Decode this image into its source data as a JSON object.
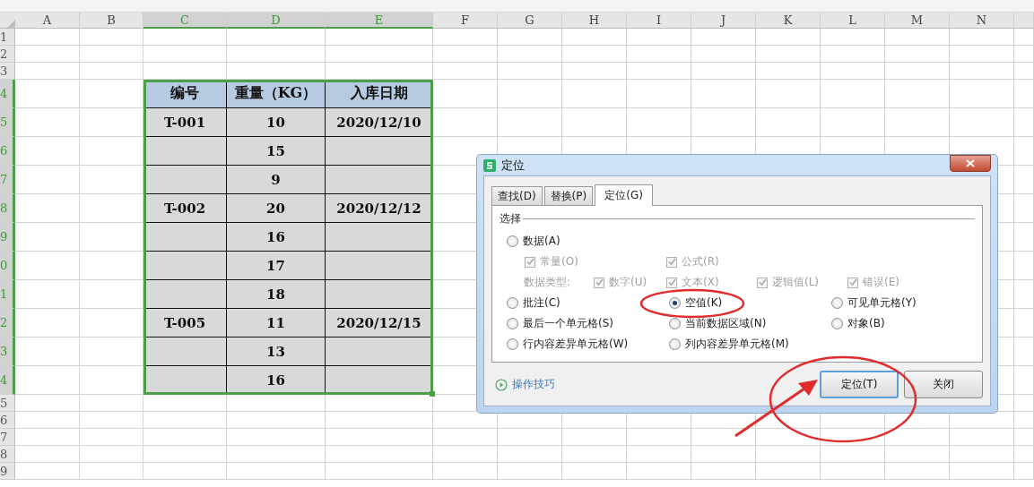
{
  "column_headers": [
    {
      "label": "A",
      "selected": false
    },
    {
      "label": "B",
      "selected": false
    },
    {
      "label": "C",
      "selected": true
    },
    {
      "label": "D",
      "selected": true
    },
    {
      "label": "E",
      "selected": true
    },
    {
      "label": "F",
      "selected": false
    },
    {
      "label": "G",
      "selected": false
    },
    {
      "label": "H",
      "selected": false
    },
    {
      "label": "I",
      "selected": false
    },
    {
      "label": "J",
      "selected": false
    },
    {
      "label": "K",
      "selected": false
    },
    {
      "label": "L",
      "selected": false
    },
    {
      "label": "M",
      "selected": false
    },
    {
      "label": "N",
      "selected": false
    }
  ],
  "row_headers": [
    {
      "label": "1",
      "selected": false
    },
    {
      "label": "2",
      "selected": false
    },
    {
      "label": "3",
      "selected": false
    },
    {
      "label": "4",
      "selected": true
    },
    {
      "label": "5",
      "selected": true
    },
    {
      "label": "6",
      "selected": true
    },
    {
      "label": "7",
      "selected": true
    },
    {
      "label": "8",
      "selected": true
    },
    {
      "label": "9",
      "selected": true
    },
    {
      "label": "0",
      "selected": true
    },
    {
      "label": "1",
      "selected": true
    },
    {
      "label": "2",
      "selected": true
    },
    {
      "label": "3",
      "selected": true
    },
    {
      "label": "4",
      "selected": true
    },
    {
      "label": "5",
      "selected": false
    },
    {
      "label": "6",
      "selected": false
    },
    {
      "label": "7",
      "selected": false
    },
    {
      "label": "8",
      "selected": false
    },
    {
      "label": "9",
      "selected": false
    }
  ],
  "table": {
    "columns": [
      "编号",
      "重量（KG）",
      "入库日期"
    ],
    "rows": [
      [
        "T-001",
        "10",
        "2020/12/10"
      ],
      [
        null,
        "15",
        null
      ],
      [
        null,
        "9",
        null
      ],
      [
        "T-002",
        "20",
        "2020/12/12"
      ],
      [
        null,
        "16",
        null
      ],
      [
        null,
        "17",
        null
      ],
      [
        null,
        "18",
        null
      ],
      [
        "T-005",
        "11",
        "2020/12/15"
      ],
      [
        null,
        "13",
        null
      ],
      [
        null,
        "16",
        null
      ]
    ]
  },
  "dialog": {
    "title": "定位",
    "tabs": [
      {
        "label": "查找(D)",
        "selected": false
      },
      {
        "label": "替换(P)",
        "selected": false
      },
      {
        "label": "定位(G)",
        "selected": true
      }
    ],
    "group_label": "选择",
    "rows": [
      {
        "kind": "radios",
        "items": [
          {
            "kind": "radio",
            "label": "数据(A)",
            "selected": false
          }
        ]
      },
      {
        "kind": "checks",
        "items": [
          {
            "kind": "checkbox",
            "label": "常量(O)",
            "checked": true,
            "disabled": true
          },
          {
            "kind": "checkbox",
            "label": "公式(R)",
            "checked": true,
            "disabled": true
          }
        ]
      },
      {
        "kind": "types",
        "items": [
          {
            "kind": "caption",
            "label": "数据类型:",
            "disabled": true
          },
          {
            "kind": "checkbox",
            "label": "数字(U)",
            "checked": true,
            "disabled": true
          },
          {
            "kind": "checkbox",
            "label": "文本(X)",
            "checked": true,
            "disabled": true
          },
          {
            "kind": "checkbox",
            "label": "逻辑值(L)",
            "checked": true,
            "disabled": true
          },
          {
            "kind": "checkbox",
            "label": "错误(E)",
            "checked": true,
            "disabled": true
          }
        ]
      },
      {
        "kind": "radios",
        "items": [
          {
            "kind": "radio",
            "label": "批注(C)",
            "selected": false
          },
          {
            "kind": "radio",
            "label": "空值(K)",
            "selected": true
          },
          {
            "kind": "radio",
            "label": "可见单元格(Y)",
            "selected": false
          }
        ]
      },
      {
        "kind": "radios",
        "items": [
          {
            "kind": "radio",
            "label": "最后一个单元格(S)",
            "selected": false
          },
          {
            "kind": "radio",
            "label": "当前数据区域(N)",
            "selected": false
          },
          {
            "kind": "radio",
            "label": "对象(B)",
            "selected": false
          }
        ]
      },
      {
        "kind": "radios",
        "items": [
          {
            "kind": "radio",
            "label": "行内容差异单元格(W)",
            "selected": false
          },
          {
            "kind": "radio",
            "label": "列内容差异单元格(M)",
            "selected": false
          }
        ]
      }
    ],
    "tips_link": "操作技巧",
    "buttons": [
      {
        "label": "定位(T)",
        "default": true
      },
      {
        "label": "关闭",
        "default": false
      }
    ]
  }
}
